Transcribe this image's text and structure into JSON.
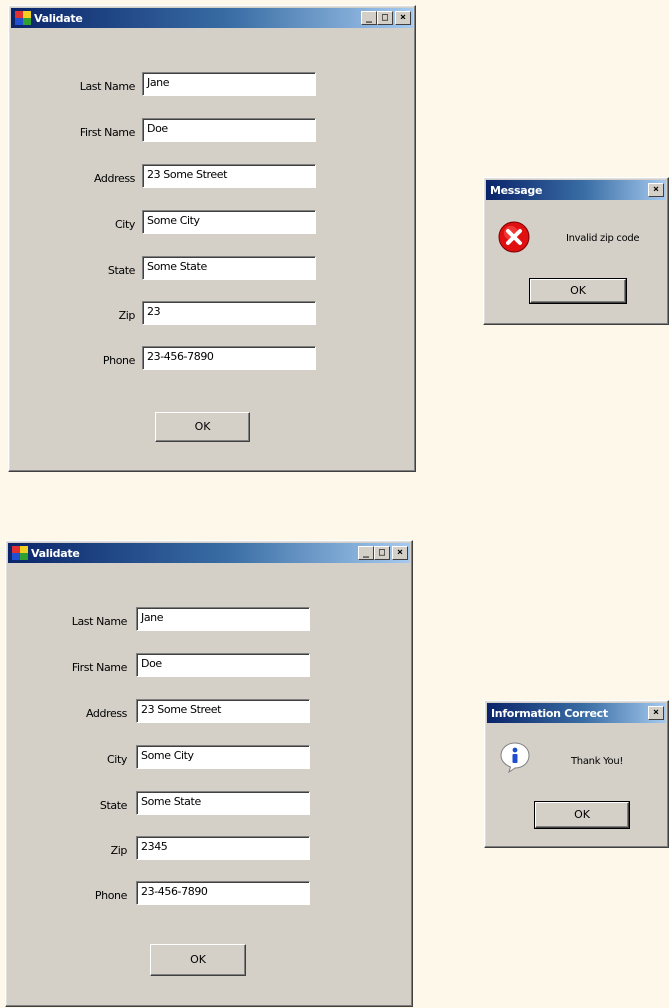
{
  "colors": {
    "desktop": "#fdf8e9",
    "window_face": "#d4d0c8",
    "titlebar_start": "#0a246a",
    "titlebar_end": "#a6caf0",
    "error_icon": "#e01010",
    "info_icon": "#1f4fd0"
  },
  "top_window": {
    "title": "Validate",
    "controls": {
      "minimize": "_",
      "maximize": "□",
      "close": "×"
    },
    "fields": [
      {
        "label": "Last Name",
        "value": "Jane"
      },
      {
        "label": "First Name",
        "value": "Doe"
      },
      {
        "label": "Address",
        "value": "23 Some Street"
      },
      {
        "label": "City",
        "value": "Some City"
      },
      {
        "label": "State",
        "value": "Some State"
      },
      {
        "label": "Zip",
        "value": "23"
      },
      {
        "label": "Phone",
        "value": "23-456-7890"
      }
    ],
    "ok_label": "OK"
  },
  "error_dialog": {
    "title": "Message",
    "close": "×",
    "icon": "error-icon",
    "text": "Invalid zip code",
    "ok_label": "OK"
  },
  "bottom_window": {
    "title": "Validate",
    "controls": {
      "minimize": "_",
      "maximize": "□",
      "close": "×"
    },
    "fields": [
      {
        "label": "Last Name",
        "value": "Jane"
      },
      {
        "label": "First Name",
        "value": "Doe"
      },
      {
        "label": "Address",
        "value": "23 Some Street"
      },
      {
        "label": "City",
        "value": "Some City"
      },
      {
        "label": "State",
        "value": "Some State"
      },
      {
        "label": "Zip",
        "value": "2345"
      },
      {
        "label": "Phone",
        "value": "23-456-7890"
      }
    ],
    "ok_label": "OK"
  },
  "info_dialog": {
    "title": "Information Correct",
    "close": "×",
    "icon": "information-icon",
    "text": "Thank You!",
    "ok_label": "OK"
  }
}
